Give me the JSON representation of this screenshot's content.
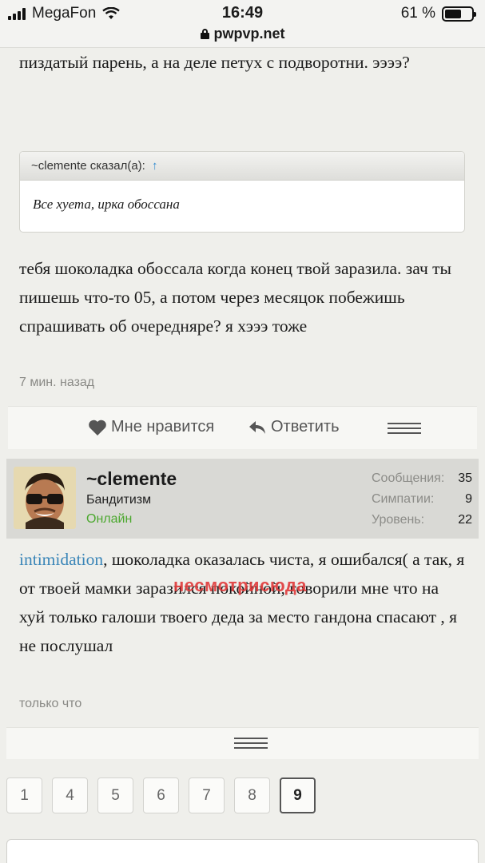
{
  "status_bar": {
    "carrier": "MegaFon",
    "time": "16:49",
    "battery": "61 %",
    "battery_level": 0.61,
    "url": "pwpvp.net"
  },
  "post1": {
    "text_top": "пиздатый парень, а на деле петух с подворотни. ээээ?",
    "quote": {
      "author": "~clemente сказал(а):",
      "arrow": "↑",
      "text": "Все хуета, ирка обоссана"
    },
    "text_main": "тебя шоколадка обоссала когда конец твой заразила. зач ты пишешь что-то 05, а потом через месяцок побежишь спрашивать об очередняре? я хэээ тоже",
    "time": "7 мин. назад"
  },
  "actions": {
    "like_label": "Мне нравится",
    "reply_label": "Ответить"
  },
  "user": {
    "name": "~clemente",
    "title": "Бандитизм",
    "status": "Онлайн",
    "stats": [
      {
        "label": "Сообщения:",
        "value": "35"
      },
      {
        "label": "Симпатии:",
        "value": "9"
      },
      {
        "label": "Уровень:",
        "value": "22"
      }
    ]
  },
  "post2": {
    "mention": "intimidation",
    "text": ", шоколадка оказалась чиста, я ошибался( а так, я от твоей мамки заразился покойной, говорили мне что на хуй только галоши твоего деда за место гандона спасают , я не послушал",
    "watermark": "несмотрисюда",
    "time": "только что"
  },
  "pagination": {
    "pages": [
      "1",
      "4",
      "5",
      "6",
      "7",
      "8",
      "9"
    ],
    "current": "9"
  },
  "colors": {
    "background": "#efefeb",
    "online": "#4ba82e",
    "mention": "#3b86b8",
    "watermark": "#e03a3a",
    "quote_arrow": "#2f8ad0"
  }
}
